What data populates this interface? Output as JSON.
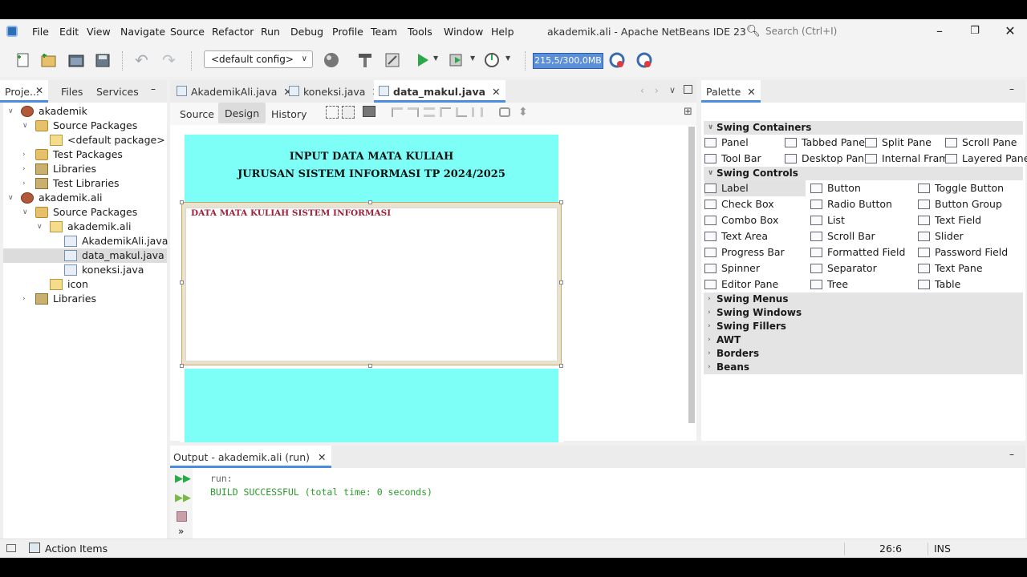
{
  "menu": [
    "File",
    "Edit",
    "View",
    "Navigate",
    "Source",
    "Refactor",
    "Run",
    "Debug",
    "Profile",
    "Team",
    "Tools",
    "Window",
    "Help"
  ],
  "window_title": "akademik.ali - Apache NetBeans IDE 23",
  "search_placeholder": "Search (Ctrl+I)",
  "toolbar": {
    "config": "<default config>",
    "memory": "215,5/300,0MB"
  },
  "left_tabs": [
    "Proje...",
    "Files",
    "Services"
  ],
  "tree": [
    {
      "label": "akademik",
      "indent": 0,
      "icon": "project-icon",
      "caret": "v"
    },
    {
      "label": "Source Packages",
      "indent": 1,
      "icon": "folder-icon",
      "caret": "v"
    },
    {
      "label": "<default package>",
      "indent": 2,
      "icon": "package-icon",
      "caret": ""
    },
    {
      "label": "Test Packages",
      "indent": 1,
      "icon": "folder-icon",
      "caret": ">"
    },
    {
      "label": "Libraries",
      "indent": 1,
      "icon": "library-icon",
      "caret": ">"
    },
    {
      "label": "Test Libraries",
      "indent": 1,
      "icon": "library-icon",
      "caret": ">"
    },
    {
      "label": "akademik.ali",
      "indent": 0,
      "icon": "project-icon",
      "caret": "v"
    },
    {
      "label": "Source Packages",
      "indent": 1,
      "icon": "folder-icon",
      "caret": "v"
    },
    {
      "label": "akademik.ali",
      "indent": 2,
      "icon": "package-icon",
      "caret": "v"
    },
    {
      "label": "AkademikAli.java",
      "indent": 3,
      "icon": "java-file-icon",
      "caret": ""
    },
    {
      "label": "data_makul.java",
      "indent": 3,
      "icon": "java-file-icon",
      "caret": "",
      "selected": true
    },
    {
      "label": "koneksi.java",
      "indent": 3,
      "icon": "java-file-icon",
      "caret": ""
    },
    {
      "label": "icon",
      "indent": 2,
      "icon": "package-icon",
      "caret": ""
    },
    {
      "label": "Libraries",
      "indent": 1,
      "icon": "library-icon",
      "caret": ">"
    }
  ],
  "editor_tabs": [
    "AkademikAli.java",
    "koneksi.java",
    "data_makul.java"
  ],
  "editor_subtabs": [
    "Source",
    "Design",
    "History"
  ],
  "form": {
    "title_line1": "INPUT DATA MATA KULIAH",
    "title_line2": "JURUSAN SISTEM INFORMASI TP 2024/2025",
    "panel_border_title": "DATA MATA KULIAH SISTEM INFORMASI",
    "bg_color": "#7dfff8",
    "border_title_color": "#a0203a"
  },
  "palette": {
    "tab": "Palette",
    "categories": [
      "Swing Containers",
      "Swing Controls",
      "Swing Menus",
      "Swing Windows",
      "Swing Fillers",
      "AWT",
      "Borders",
      "Beans"
    ],
    "containers": [
      "Panel",
      "Tabbed Pane",
      "Split Pane",
      "Scroll Pane",
      "Tool Bar",
      "Desktop Pane",
      "Internal Frame",
      "Layered Pane"
    ],
    "controls": [
      "Label",
      "Button",
      "Toggle Button",
      "Check Box",
      "Radio Button",
      "Button Group",
      "Combo Box",
      "List",
      "Text Field",
      "Text Area",
      "Scroll Bar",
      "Slider",
      "Progress Bar",
      "Formatted Field",
      "Password Field",
      "Spinner",
      "Separator",
      "Text Pane",
      "Editor Pane",
      "Tree",
      "Table"
    ]
  },
  "output": {
    "tab": "Output - akademik.ali (run)",
    "line1": "run:",
    "line2": "BUILD SUCCESSFUL (total time: 0 seconds)"
  },
  "status": {
    "action_items": "Action Items",
    "position": "26:6",
    "mode": "INS"
  }
}
